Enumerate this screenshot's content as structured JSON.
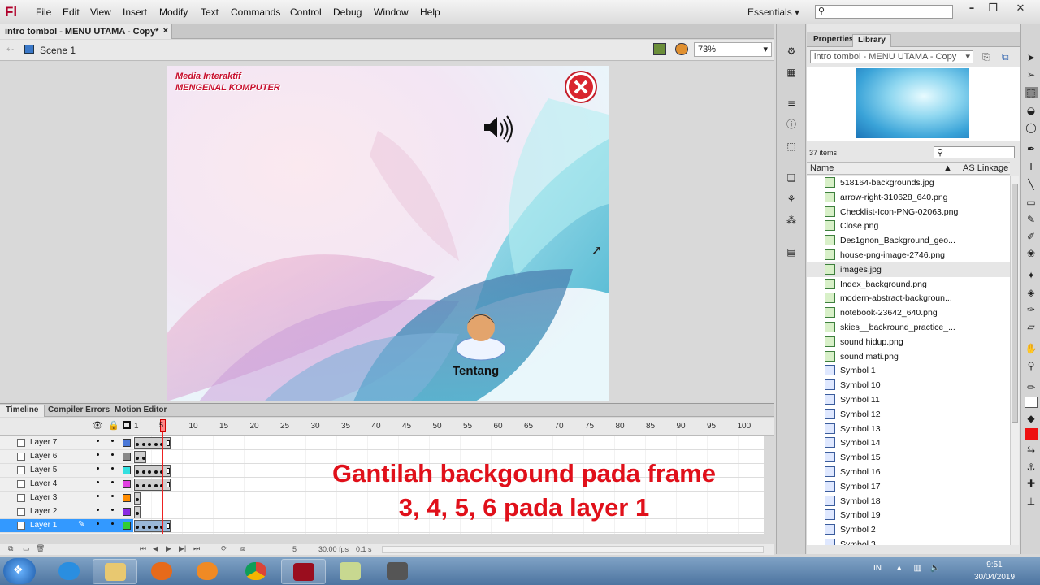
{
  "app": {
    "logo": "Fl"
  },
  "menu": [
    "File",
    "Edit",
    "View",
    "Insert",
    "Modify",
    "Text",
    "Commands",
    "Control",
    "Debug",
    "Window",
    "Help"
  ],
  "workspace": "Essentials",
  "document": {
    "tab_title": "intro tombol - MENU UTAMA - Copy*",
    "scene": "Scene 1",
    "zoom": "73%"
  },
  "stage": {
    "title_line1": "Media Interaktif",
    "title_line2": "MENGENAL KOMPUTER",
    "tentang_label": "Tentang"
  },
  "panels": {
    "tabs": [
      "Properties",
      "Library"
    ],
    "library_doc": "intro tombol - MENU UTAMA - Copy",
    "item_count": "37 items",
    "col_name": "Name",
    "col_linkage": "AS Linkage",
    "items": [
      {
        "name": "518164-backgrounds.jpg",
        "type": "bitmap"
      },
      {
        "name": "arrow-right-310628_640.png",
        "type": "bitmap"
      },
      {
        "name": "Checklist-Icon-PNG-02063.png",
        "type": "bitmap"
      },
      {
        "name": "Close.png",
        "type": "bitmap"
      },
      {
        "name": "Des1gnon_Background_geo...",
        "type": "bitmap"
      },
      {
        "name": "house-png-image-2746.png",
        "type": "bitmap"
      },
      {
        "name": "images.jpg",
        "type": "bitmap"
      },
      {
        "name": "Index_background.png",
        "type": "bitmap"
      },
      {
        "name": "modern-abstract-backgroun...",
        "type": "bitmap"
      },
      {
        "name": "notebook-23642_640.png",
        "type": "bitmap"
      },
      {
        "name": "skies__backround_practice_...",
        "type": "bitmap"
      },
      {
        "name": "sound hidup.png",
        "type": "bitmap"
      },
      {
        "name": "sound mati.png",
        "type": "bitmap"
      },
      {
        "name": "Symbol 1",
        "type": "symbol"
      },
      {
        "name": "Symbol 10",
        "type": "symbol"
      },
      {
        "name": "Symbol 11",
        "type": "symbol"
      },
      {
        "name": "Symbol 12",
        "type": "symbol"
      },
      {
        "name": "Symbol 13",
        "type": "symbol"
      },
      {
        "name": "Symbol 14",
        "type": "symbol"
      },
      {
        "name": "Symbol 15",
        "type": "symbol"
      },
      {
        "name": "Symbol 16",
        "type": "symbol"
      },
      {
        "name": "Symbol 17",
        "type": "symbol"
      },
      {
        "name": "Symbol 18",
        "type": "symbol"
      },
      {
        "name": "Symbol 19",
        "type": "symbol"
      },
      {
        "name": "Symbol 2",
        "type": "symbol"
      },
      {
        "name": "Symbol 3",
        "type": "symbol"
      }
    ]
  },
  "timeline": {
    "tabs": [
      "Timeline",
      "Compiler Errors",
      "Motion Editor"
    ],
    "ruler": [
      "1",
      "5",
      "10",
      "15",
      "20",
      "25",
      "30",
      "35",
      "40",
      "45",
      "50",
      "55",
      "60",
      "65",
      "70",
      "75",
      "80",
      "85",
      "90",
      "95",
      "100"
    ],
    "layers": [
      {
        "name": "Layer 7",
        "color": "#4a78d8",
        "frames": 6
      },
      {
        "name": "Layer 6",
        "color": "#888888",
        "frames": 2
      },
      {
        "name": "Layer 5",
        "color": "#33e0e0",
        "frames": 6
      },
      {
        "name": "Layer 4",
        "color": "#e040e0",
        "frames": 6
      },
      {
        "name": "Layer 3",
        "color": "#ff8c00",
        "frames": 1
      },
      {
        "name": "Layer 2",
        "color": "#8a2be2",
        "frames": 1
      },
      {
        "name": "Layer 1",
        "color": "#33cc33",
        "frames": 6,
        "selected": true
      }
    ],
    "current_frame": "5",
    "fps": "30.00 fps",
    "elapsed": "0.1 s"
  },
  "overlay": {
    "line1": "Gantilah backgound pada frame",
    "line2": "3, 4, 5, 6 pada layer 1"
  },
  "taskbar": {
    "lang": "IN",
    "time": "9:51",
    "date": "30/04/2019"
  }
}
